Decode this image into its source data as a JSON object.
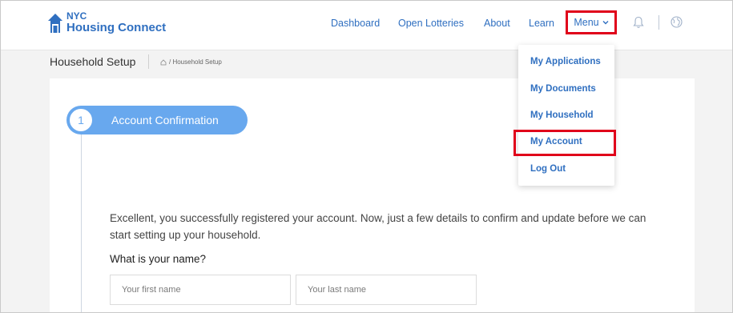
{
  "header": {
    "logo_line1": "NYC",
    "logo_line2": "Housing Connect",
    "nav": {
      "dashboard": "Dashboard",
      "open_lotteries": "Open Lotteries",
      "about": "About",
      "learn": "Learn",
      "menu": "Menu"
    }
  },
  "subbar": {
    "page_title": "Household Setup",
    "breadcrumb": "/ Household Setup"
  },
  "menu_dropdown": {
    "items": [
      "My Applications",
      "My Documents",
      "My Household",
      "My Account",
      "Log Out"
    ]
  },
  "step": {
    "number": "1",
    "label": "Account Confirmation"
  },
  "form": {
    "intro": "Excellent, you successfully registered your account. Now, just a few details to confirm and update before we can start setting up your household.",
    "question": "What is your name?",
    "first_name_placeholder": "Your first name",
    "last_name_placeholder": "Your last name"
  },
  "colors": {
    "brand_blue": "#2f6fc0",
    "step_blue": "#68a8ee",
    "highlight_red": "#e0001a"
  }
}
